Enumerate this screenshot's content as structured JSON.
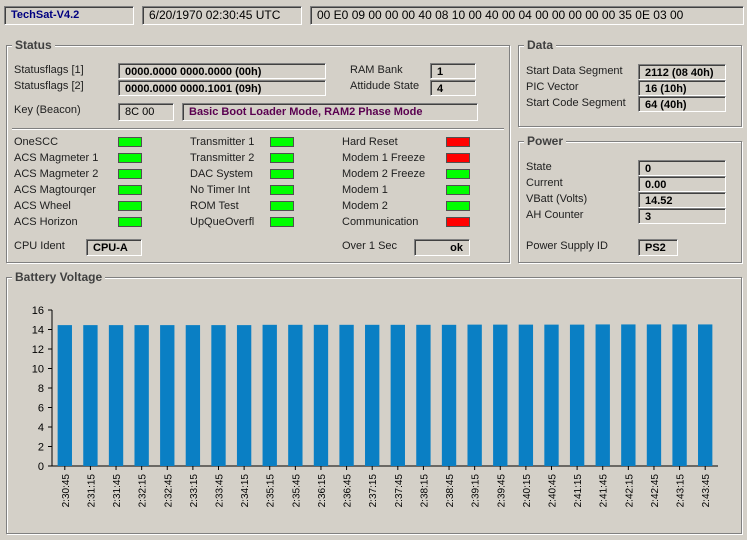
{
  "header": {
    "app_title": "TechSat-V4.2",
    "datetime": "6/20/1970 02:30:45 UTC",
    "hexdump": "00 E0 09 00 00 00 40 08 10 00 40 00 04 00 00 00 00 00 35 0E 03 00"
  },
  "status": {
    "title": "Status",
    "statusflags1_label": "Statusflags [1]",
    "statusflags1_value": "0000.0000 0000.0000  (00h)",
    "statusflags2_label": "Statusflags [2]",
    "statusflags2_value": "0000.0000 0000.1001  (09h)",
    "ram_bank_label": "RAM Bank",
    "ram_bank_value": "1",
    "attitude_state_label": "Attidude State",
    "attitude_state_value": "4",
    "key_label": "Key (Beacon)",
    "key_value": "8C 00",
    "mode_value": "Basic Boot Loader Mode, RAM2 Phase Mode",
    "indicators_col1": [
      {
        "label": "OneSCC",
        "state": "green"
      },
      {
        "label": "ACS Magmeter 1",
        "state": "green"
      },
      {
        "label": "ACS Magmeter 2",
        "state": "green"
      },
      {
        "label": "ACS Magtourqer",
        "state": "green"
      },
      {
        "label": "ACS Wheel",
        "state": "green"
      },
      {
        "label": "ACS Horizon",
        "state": "green"
      }
    ],
    "indicators_col2": [
      {
        "label": "Transmitter 1",
        "state": "green"
      },
      {
        "label": "Transmitter 2",
        "state": "green"
      },
      {
        "label": "DAC System",
        "state": "green"
      },
      {
        "label": "No Timer Int",
        "state": "green"
      },
      {
        "label": "ROM Test",
        "state": "green"
      },
      {
        "label": "UpQueOverfl",
        "state": "green"
      }
    ],
    "indicators_col3": [
      {
        "label": "Hard Reset",
        "state": "red"
      },
      {
        "label": "Modem 1 Freeze",
        "state": "red"
      },
      {
        "label": "Modem 2 Freeze",
        "state": "green"
      },
      {
        "label": "Modem 1",
        "state": "green"
      },
      {
        "label": "Modem 2",
        "state": "green"
      },
      {
        "label": "Communication",
        "state": "red"
      }
    ],
    "cpu_ident_label": "CPU Ident",
    "cpu_ident_value": "CPU-A",
    "over1sec_label": "Over 1 Sec",
    "over1sec_value": "ok"
  },
  "data_panel": {
    "title": "Data",
    "start_data_segment_label": "Start Data Segment",
    "start_data_segment_value": "2112  (08 40h)",
    "pic_vector_label": "PIC Vector",
    "pic_vector_value": "16  (10h)",
    "start_code_segment_label": "Start Code Segment",
    "start_code_segment_value": "64  (40h)"
  },
  "power": {
    "title": "Power",
    "state_label": "State",
    "state_value": "0",
    "current_label": "Current",
    "current_value": "0.00",
    "vbatt_label": "VBatt (Volts)",
    "vbatt_value": "14.52",
    "ah_counter_label": "AH Counter",
    "ah_counter_value": "3",
    "psu_id_label": "Power Supply ID",
    "psu_id_value": "PS2"
  },
  "colors": {
    "bar": "#0a7fc4",
    "led_green": "#00ff00",
    "led_red": "#ff0000",
    "background": "#d4d0c8"
  },
  "chart_data": {
    "type": "bar",
    "title": "Battery Voltage",
    "xlabel": "",
    "ylabel": "",
    "ylim": [
      0,
      16
    ],
    "yticks": [
      0,
      2,
      4,
      6,
      8,
      10,
      12,
      14,
      16
    ],
    "grid": false,
    "categories": [
      "2:30:45",
      "2:31:15",
      "2:31:45",
      "2:32:15",
      "2:32:45",
      "2:33:15",
      "2:33:45",
      "2:34:15",
      "2:35:15",
      "2:35:45",
      "2:36:15",
      "2:36:45",
      "2:37:15",
      "2:37:45",
      "2:38:15",
      "2:38:45",
      "2:39:15",
      "2:39:45",
      "2:40:15",
      "2:40:45",
      "2:41:15",
      "2:41:45",
      "2:42:15",
      "2:42:45",
      "2:43:15",
      "2:43:45"
    ],
    "values": [
      14.45,
      14.45,
      14.45,
      14.45,
      14.45,
      14.45,
      14.45,
      14.45,
      14.48,
      14.48,
      14.48,
      14.48,
      14.48,
      14.48,
      14.48,
      14.48,
      14.5,
      14.5,
      14.5,
      14.5,
      14.5,
      14.52,
      14.52,
      14.52,
      14.52,
      14.52
    ]
  }
}
